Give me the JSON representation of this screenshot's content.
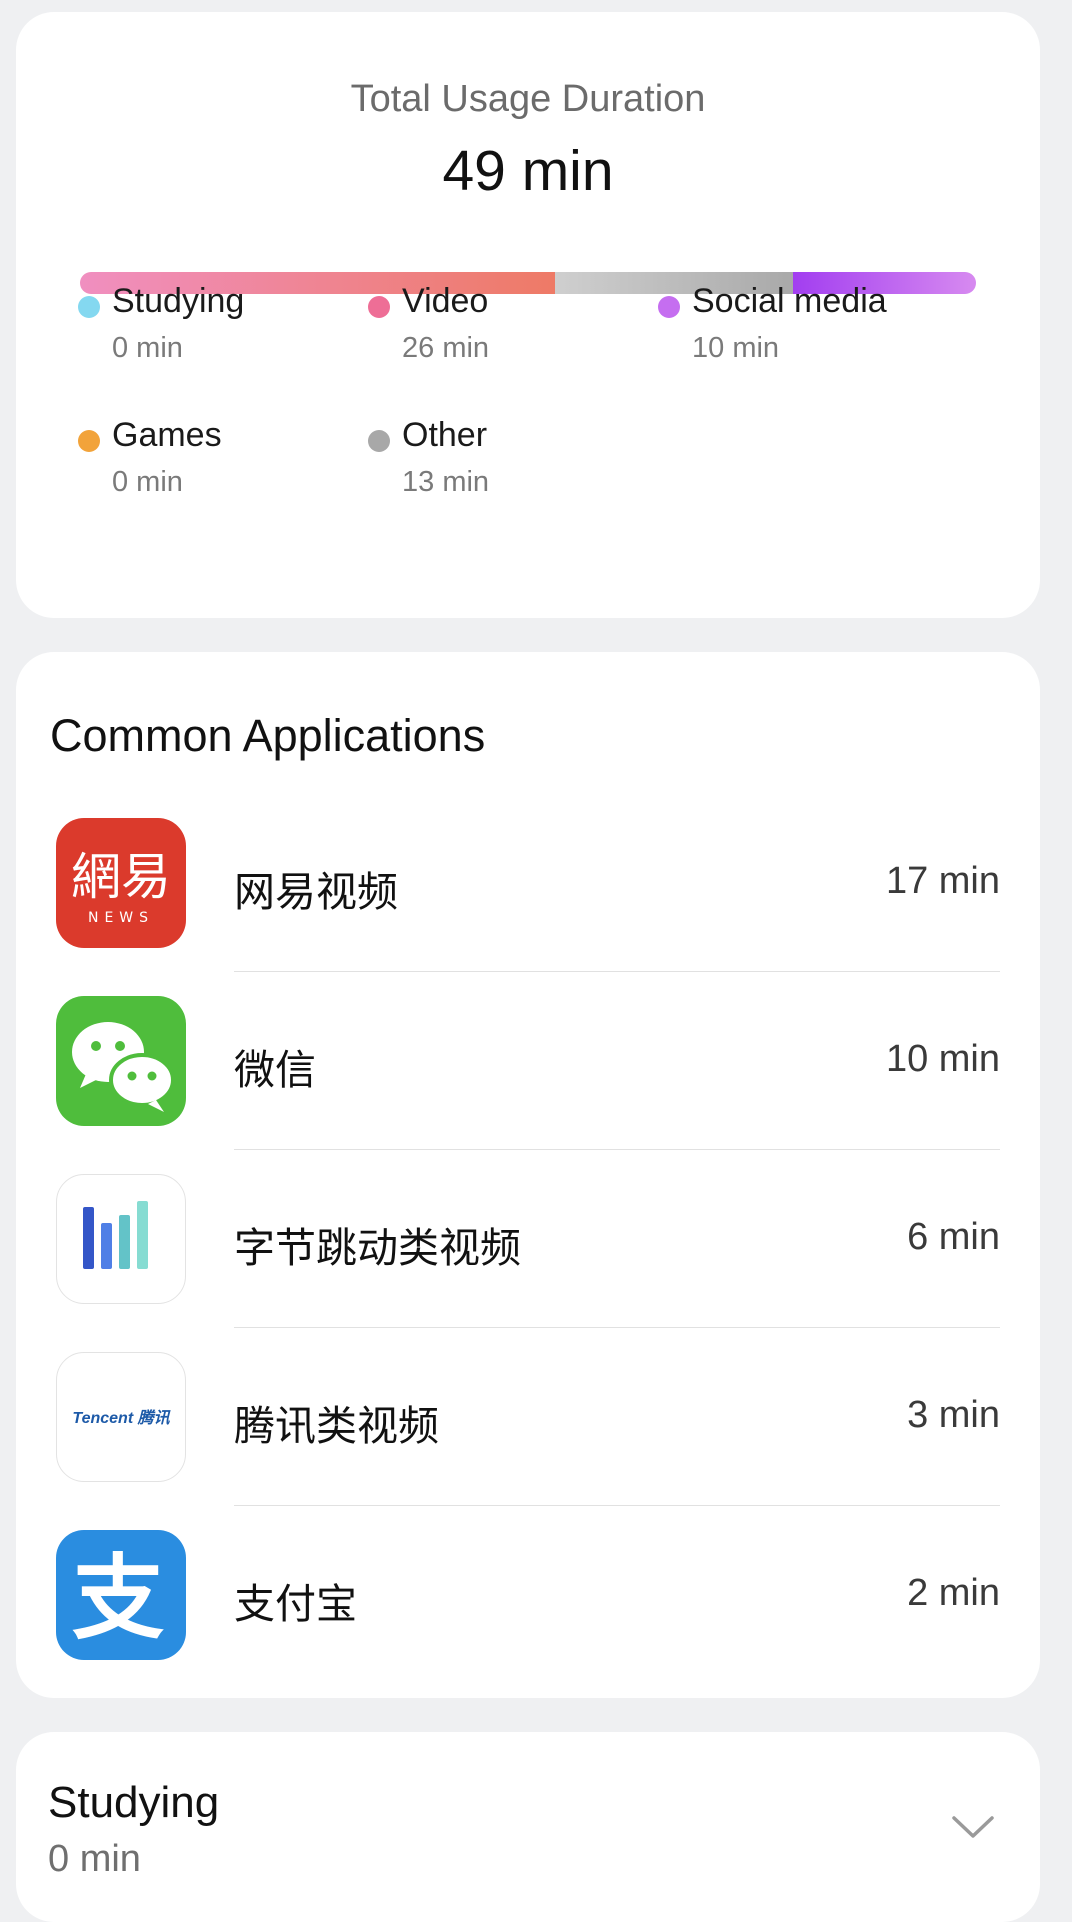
{
  "usage": {
    "title": "Total Usage Duration",
    "total": "49 min",
    "bar_segments": [
      {
        "category": "Video",
        "minutes": 26,
        "color_from": "#f08fc0",
        "color_to": "#ee7a66"
      },
      {
        "category": "Other",
        "minutes": 13,
        "color_from": "#cfcfcf",
        "color_to": "#a9a9a9"
      },
      {
        "category": "Social media",
        "minutes": 10,
        "color_from": "#a23ef0",
        "color_to": "#d78af0"
      }
    ],
    "legend": [
      {
        "name": "Studying",
        "value": "0 min",
        "color": "#84d8f0"
      },
      {
        "name": "Video",
        "value": "26 min",
        "color": "#ee6e96"
      },
      {
        "name": "Social media",
        "value": "10 min",
        "color": "#c56ef0"
      },
      {
        "name": "Games",
        "value": "0 min",
        "color": "#f2a33a"
      },
      {
        "name": "Other",
        "value": "13 min",
        "color": "#a8a8a8"
      }
    ]
  },
  "apps": {
    "title": "Common Applications",
    "items": [
      {
        "name": "网易视频",
        "time": "17 min",
        "icon": "netease-news-icon",
        "icon_text": "網易",
        "icon_subtext": "NEWS"
      },
      {
        "name": "微信",
        "time": "10 min",
        "icon": "wechat-icon"
      },
      {
        "name": "字节跳动类视频",
        "time": "6 min",
        "icon": "bytedance-icon"
      },
      {
        "name": "腾讯类视频",
        "time": "3 min",
        "icon": "tencent-icon",
        "icon_text": "Tencent 腾讯"
      },
      {
        "name": "支付宝",
        "time": "2 min",
        "icon": "alipay-icon",
        "icon_text": "支"
      }
    ]
  },
  "category": {
    "title": "Studying",
    "value": "0 min"
  }
}
